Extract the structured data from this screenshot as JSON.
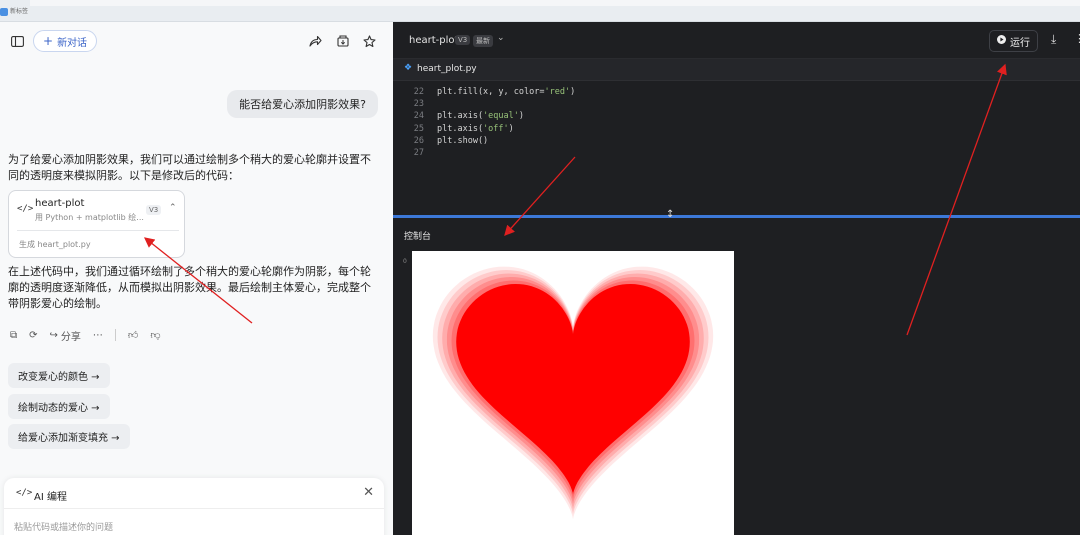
{
  "topbar": {
    "app_name": "新标签"
  },
  "chat": {
    "new_chat_label": "新对话",
    "user_message": "能否给爱心添加阴影效果?",
    "ai_intro": "为了给爱心添加阴影效果，我们可以通过绘制多个稍大的爱心轮廓并设置不同的透明度来模拟阴影。以下是修改后的代码：",
    "code_card": {
      "title": "heart-plot",
      "subtitle": "用 Python + matplotlib 绘...",
      "version": "V3",
      "file_label": "生成 heart_plot.py"
    },
    "ai_outro": "在上述代码中，我们通过循环绘制了多个稍大的爱心轮廓作为阴影，每个轮廓的透明度逐渐降低，从而模拟出阴影效果。最后绘制主体爱心，完成整个带阴影爱心的绘制。",
    "share_label": "分享",
    "suggestions": [
      "改变爱心的颜色 →",
      "绘制动态的爱心 →",
      "给爱心添加渐变填充 →"
    ],
    "input": {
      "label": "AI 编程",
      "placeholder": "粘贴代码或描述你的问题"
    }
  },
  "editor": {
    "title": "heart-plot",
    "version_badge": "V3",
    "latest_badge": "最新",
    "run_label": "运行",
    "file_tab": "heart_plot.py",
    "code_lines": [
      {
        "n": "22",
        "pre": "plt.fill(x, y, color=",
        "str": "'red'",
        "post": ")"
      },
      {
        "n": "23",
        "pre": "",
        "str": "",
        "post": ""
      },
      {
        "n": "24",
        "pre": "plt.axis(",
        "str": "'equal'",
        "post": ")"
      },
      {
        "n": "25",
        "pre": "plt.axis(",
        "str": "'off'",
        "post": ")"
      },
      {
        "n": "26",
        "pre": "plt.show()",
        "str": "",
        "post": ""
      },
      {
        "n": "27",
        "pre": "",
        "str": "",
        "post": ""
      }
    ],
    "console_title": "控制台",
    "console_index": "0"
  },
  "colors": {
    "accent": "#3c78d8",
    "heart": "#ff0000",
    "arrow": "#e02020"
  }
}
